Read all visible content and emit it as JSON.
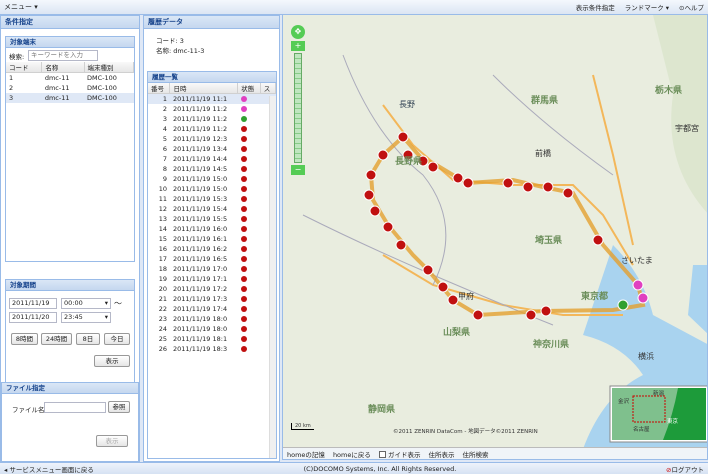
{
  "topbar": {
    "menu": "メニュー ▾",
    "display_settings": "表示条件指定",
    "landmark": "ランドマーク ▾",
    "help": "ヘルプ"
  },
  "left": {
    "title": "条件指定",
    "terminal": {
      "title": "対象端末",
      "search_label": "検索:",
      "search_placeholder": "キーワードを入力",
      "columns": [
        "コード",
        "名称",
        "端末種別"
      ],
      "rows": [
        [
          "1",
          "dmc-11",
          "DMC-100"
        ],
        [
          "2",
          "dmc-11",
          "DMC-100"
        ],
        [
          "3",
          "dmc-11",
          "DMC-100"
        ]
      ]
    },
    "period": {
      "title": "対象期間",
      "date_from": "2011/11/19",
      "time_from": "00:00",
      "tilde": "〜",
      "date_to": "2011/11/20",
      "time_to": "23:45",
      "buttons": [
        "8時間",
        "24時間",
        "8日",
        "今日"
      ],
      "show": "表示"
    },
    "file": {
      "title": "ファイル指定",
      "file_label": "ファイル名:",
      "browse": "参照",
      "show": "表示"
    }
  },
  "history": {
    "title": "履歴データ",
    "code_label": "コード:",
    "code": "3",
    "name_label": "名称:",
    "name": "dmc-11-3",
    "list_title": "履歴一覧",
    "columns": [
      "番号",
      "日時",
      "状態",
      "ス"
    ],
    "rows": [
      {
        "n": "1",
        "t": "2011/11/19 11:1",
        "c": "#e040c0"
      },
      {
        "n": "2",
        "t": "2011/11/19 11:2",
        "c": "#e040c0"
      },
      {
        "n": "3",
        "t": "2011/11/19 11:2",
        "c": "#30a030"
      },
      {
        "n": "4",
        "t": "2011/11/19 11:2",
        "c": "#c01010"
      },
      {
        "n": "5",
        "t": "2011/11/19 12:3",
        "c": "#c01010"
      },
      {
        "n": "6",
        "t": "2011/11/19 13:4",
        "c": "#c01010"
      },
      {
        "n": "7",
        "t": "2011/11/19 14:4",
        "c": "#c01010"
      },
      {
        "n": "8",
        "t": "2011/11/19 14:5",
        "c": "#c01010"
      },
      {
        "n": "9",
        "t": "2011/11/19 15:0",
        "c": "#c01010"
      },
      {
        "n": "10",
        "t": "2011/11/19 15:0",
        "c": "#c01010"
      },
      {
        "n": "11",
        "t": "2011/11/19 15:3",
        "c": "#c01010"
      },
      {
        "n": "12",
        "t": "2011/11/19 15:4",
        "c": "#c01010"
      },
      {
        "n": "13",
        "t": "2011/11/19 15:5",
        "c": "#c01010"
      },
      {
        "n": "14",
        "t": "2011/11/19 16:0",
        "c": "#c01010"
      },
      {
        "n": "15",
        "t": "2011/11/19 16:1",
        "c": "#c01010"
      },
      {
        "n": "16",
        "t": "2011/11/19 16:2",
        "c": "#c01010"
      },
      {
        "n": "17",
        "t": "2011/11/19 16:5",
        "c": "#c01010"
      },
      {
        "n": "18",
        "t": "2011/11/19 17:0",
        "c": "#c01010"
      },
      {
        "n": "19",
        "t": "2011/11/19 17:1",
        "c": "#c01010"
      },
      {
        "n": "20",
        "t": "2011/11/19 17:2",
        "c": "#c01010"
      },
      {
        "n": "21",
        "t": "2011/11/19 17:3",
        "c": "#c01010"
      },
      {
        "n": "22",
        "t": "2011/11/19 17:4",
        "c": "#c01010"
      },
      {
        "n": "23",
        "t": "2011/11/19 18:0",
        "c": "#c01010"
      },
      {
        "n": "24",
        "t": "2011/11/19 18:0",
        "c": "#c01010"
      },
      {
        "n": "25",
        "t": "2011/11/19 18:1",
        "c": "#c01010"
      },
      {
        "n": "26",
        "t": "2011/11/19 18:3",
        "c": "#c01010"
      }
    ]
  },
  "map": {
    "labels": {
      "nagano": "長野",
      "gunma": "群馬県",
      "tochigi": "栃木県",
      "utsunomiya": "宇都宮",
      "maebashi": "前橋",
      "saitama_pref": "埼玉県",
      "saitama": "さいたま",
      "tokyo": "東京都",
      "kofu": "甲府",
      "yamanashi": "山梨県",
      "kanagawa": "神奈川県",
      "shizuoka": "静岡県",
      "yokohama": "横浜",
      "nagano_pref": "長野県"
    },
    "copyright": "©2011 ZENRIN DataCom - 地図データ©2011 ZENRIN",
    "bar": {
      "home_set": "homeの記憶",
      "home_go": "homeに戻る",
      "guide": "ガイド表示",
      "resident": "住所表示",
      "resident_search": "住所検索"
    },
    "mini": {
      "niigata": "新潟",
      "kanazawa": "金沢",
      "tokyo": "東京",
      "nagoya": "名古屋"
    },
    "scale": "20 km"
  },
  "footer": {
    "back": "サービスメニュー画面に戻る",
    "copyright": "(C)DOCOMO Systems, Inc. All Rights Reserved.",
    "logout": "ログアウト"
  }
}
